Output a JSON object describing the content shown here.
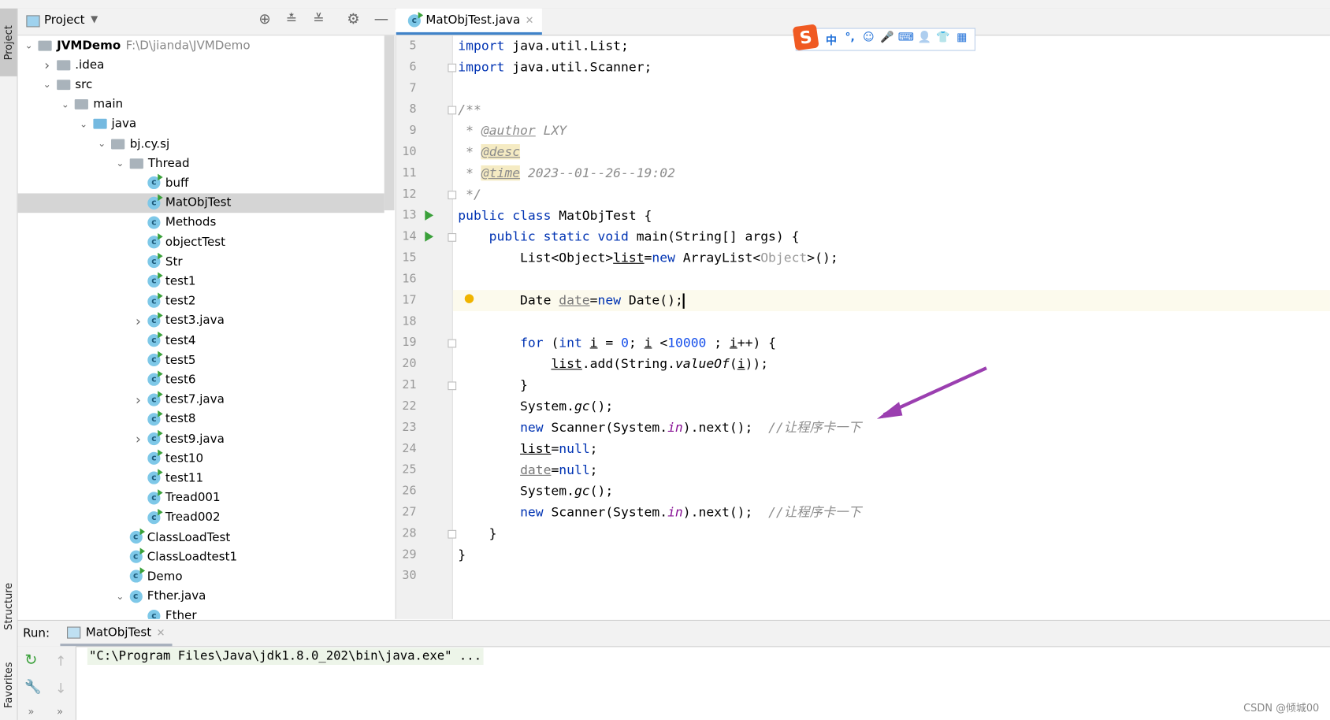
{
  "side_tabs": {
    "project": "Project",
    "structure": "Structure",
    "favorites": "Favorites"
  },
  "project_panel": {
    "title": "Project"
  },
  "tree": [
    {
      "label": "JVMDemo",
      "path": "F:\\D\\jianda\\JVMDemo",
      "level": 0,
      "icon": "module",
      "chevron": "down",
      "bold": true
    },
    {
      "label": ".idea",
      "level": 1,
      "icon": "folder",
      "chevron": "right"
    },
    {
      "label": "src",
      "level": 1,
      "icon": "folder",
      "chevron": "down"
    },
    {
      "label": "main",
      "level": 2,
      "icon": "folder",
      "chevron": "down"
    },
    {
      "label": "java",
      "level": 3,
      "icon": "source-folder",
      "chevron": "down"
    },
    {
      "label": "bj.cy.sj",
      "level": 4,
      "icon": "package",
      "chevron": "down"
    },
    {
      "label": "Thread",
      "level": 5,
      "icon": "package",
      "chevron": "down"
    },
    {
      "label": "buff",
      "level": 6,
      "icon": "class-run"
    },
    {
      "label": "MatObjTest",
      "level": 6,
      "icon": "class-run",
      "selected": true
    },
    {
      "label": "Methods",
      "level": 6,
      "icon": "class"
    },
    {
      "label": "objectTest",
      "level": 6,
      "icon": "class-run"
    },
    {
      "label": "Str",
      "level": 6,
      "icon": "class-run"
    },
    {
      "label": "test1",
      "level": 6,
      "icon": "class-run"
    },
    {
      "label": "test2",
      "level": 6,
      "icon": "class-run"
    },
    {
      "label": "test3.java",
      "level": 6,
      "icon": "class-run",
      "chevron": "right"
    },
    {
      "label": "test4",
      "level": 6,
      "icon": "class-run"
    },
    {
      "label": "test5",
      "level": 6,
      "icon": "class-run"
    },
    {
      "label": "test6",
      "level": 6,
      "icon": "class-run"
    },
    {
      "label": "test7.java",
      "level": 6,
      "icon": "class-run",
      "chevron": "right"
    },
    {
      "label": "test8",
      "level": 6,
      "icon": "class-run"
    },
    {
      "label": "test9.java",
      "level": 6,
      "icon": "class-run",
      "chevron": "right"
    },
    {
      "label": "test10",
      "level": 6,
      "icon": "class-run"
    },
    {
      "label": "test11",
      "level": 6,
      "icon": "class-run"
    },
    {
      "label": "Tread001",
      "level": 6,
      "icon": "class-run"
    },
    {
      "label": "Tread002",
      "level": 6,
      "icon": "class-run"
    },
    {
      "label": "ClassLoadTest",
      "level": 5,
      "icon": "class-run"
    },
    {
      "label": "ClassLoadtest1",
      "level": 5,
      "icon": "class-run"
    },
    {
      "label": "Demo",
      "level": 5,
      "icon": "class-run"
    },
    {
      "label": "Fther.java",
      "level": 5,
      "icon": "class",
      "chevron": "down"
    },
    {
      "label": "Fther",
      "level": 6,
      "icon": "class"
    }
  ],
  "editor": {
    "tab_label": "MatObjTest.java",
    "current_line": 17,
    "lines": [
      {
        "n": "5",
        "t": [
          [
            "kw",
            "import "
          ],
          [
            "",
            "java.util.List;"
          ]
        ]
      },
      {
        "n": "6",
        "t": [
          [
            "kw",
            "import "
          ],
          [
            "",
            "java.util.Scanner;"
          ]
        ]
      },
      {
        "n": "7",
        "t": []
      },
      {
        "n": "8",
        "t": [
          [
            "cm",
            "/**"
          ]
        ]
      },
      {
        "n": "9",
        "t": [
          [
            "cm",
            " * "
          ],
          [
            "tag",
            "@author"
          ],
          [
            "cm",
            " LXY"
          ]
        ]
      },
      {
        "n": "10",
        "t": [
          [
            "cm",
            " * "
          ],
          [
            "tagh",
            "@desc"
          ]
        ]
      },
      {
        "n": "11",
        "t": [
          [
            "cm",
            " * "
          ],
          [
            "tagh",
            "@time"
          ],
          [
            "cm",
            " 2023--01--26--19:02"
          ]
        ]
      },
      {
        "n": "12",
        "t": [
          [
            "cm",
            " */"
          ]
        ]
      },
      {
        "n": "13",
        "t": [
          [
            "kw",
            "public class "
          ],
          [
            "",
            "MatObjTest {"
          ]
        ]
      },
      {
        "n": "14",
        "t": [
          [
            "",
            "    "
          ],
          [
            "kw",
            "public static void "
          ],
          [
            "",
            "main(String[] args) {"
          ]
        ]
      },
      {
        "n": "15",
        "t": [
          [
            "",
            "        List<Object>"
          ],
          [
            "ul",
            "list"
          ],
          [
            "",
            "="
          ],
          [
            "kw",
            "new "
          ],
          [
            "",
            "ArrayList<"
          ],
          [
            "gr",
            "Object"
          ],
          [
            "",
            ">();"
          ]
        ]
      },
      {
        "n": "16",
        "t": []
      },
      {
        "n": "17",
        "t": [
          [
            "",
            "        Date "
          ],
          [
            "ulg",
            "date"
          ],
          [
            "",
            "="
          ],
          [
            "kw",
            "new "
          ],
          [
            "",
            "Date();"
          ]
        ]
      },
      {
        "n": "18",
        "t": []
      },
      {
        "n": "19",
        "t": [
          [
            "",
            "        "
          ],
          [
            "kw",
            "for "
          ],
          [
            "",
            "("
          ],
          [
            "kw",
            "int "
          ],
          [
            "ul",
            "i"
          ],
          [
            "",
            " = "
          ],
          [
            "num",
            "0"
          ],
          [
            "",
            "; "
          ],
          [
            "ul",
            "i"
          ],
          [
            "",
            " <"
          ],
          [
            "num",
            "10000"
          ],
          [
            "",
            " ; "
          ],
          [
            "ul",
            "i"
          ],
          [
            "",
            "++) {"
          ]
        ]
      },
      {
        "n": "20",
        "t": [
          [
            "",
            "            "
          ],
          [
            "ul",
            "list"
          ],
          [
            "",
            ".add(String."
          ],
          [
            "it",
            "valueOf"
          ],
          [
            "",
            "("
          ],
          [
            "ul",
            "i"
          ],
          [
            "",
            "));"
          ]
        ]
      },
      {
        "n": "21",
        "t": [
          [
            "",
            "        }"
          ]
        ]
      },
      {
        "n": "22",
        "t": [
          [
            "",
            "        System."
          ],
          [
            "it",
            "gc"
          ],
          [
            "",
            "();"
          ]
        ]
      },
      {
        "n": "23",
        "t": [
          [
            "",
            "        "
          ],
          [
            "kw",
            "new "
          ],
          [
            "",
            "Scanner(System."
          ],
          [
            "st",
            "in"
          ],
          [
            "",
            ").next();  "
          ],
          [
            "cm",
            "//让程序卡一下"
          ]
        ]
      },
      {
        "n": "24",
        "t": [
          [
            "",
            "        "
          ],
          [
            "ul",
            "list"
          ],
          [
            "",
            "="
          ],
          [
            "kw",
            "null"
          ],
          [
            "",
            ";"
          ]
        ]
      },
      {
        "n": "25",
        "t": [
          [
            "",
            "        "
          ],
          [
            "ulg",
            "date"
          ],
          [
            "",
            "="
          ],
          [
            "kw",
            "null"
          ],
          [
            "",
            ";"
          ]
        ]
      },
      {
        "n": "26",
        "t": [
          [
            "",
            "        System."
          ],
          [
            "it",
            "gc"
          ],
          [
            "",
            "();"
          ]
        ]
      },
      {
        "n": "27",
        "t": [
          [
            "",
            "        "
          ],
          [
            "kw",
            "new "
          ],
          [
            "",
            "Scanner(System."
          ],
          [
            "st",
            "in"
          ],
          [
            "",
            ").next();  "
          ],
          [
            "cm",
            "//让程序卡一下"
          ]
        ]
      },
      {
        "n": "28",
        "t": [
          [
            "",
            "    }"
          ]
        ]
      },
      {
        "n": "29",
        "t": [
          [
            "",
            "}"
          ]
        ]
      },
      {
        "n": "30",
        "t": []
      }
    ]
  },
  "ime_toolbar": {
    "items": [
      "中",
      "°,",
      "☺",
      "🎤",
      "⌨",
      "👤",
      "👕",
      "▦"
    ]
  },
  "run": {
    "label": "Run:",
    "tab_label": "MatObjTest",
    "console": "\"C:\\Program Files\\Java\\jdk1.8.0_202\\bin\\java.exe\" ..."
  },
  "watermark": "CSDN @倾城00",
  "colors": {
    "accent": "#4083c9",
    "annotation_arrow": "#9b3fb0",
    "keyword": "#0033b3"
  }
}
